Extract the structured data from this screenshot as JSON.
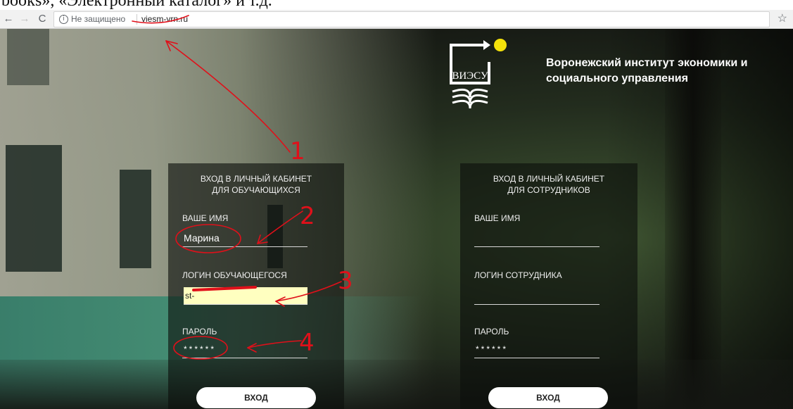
{
  "document_strip_text": "books», «Электронный каталог» и т.д.",
  "browser": {
    "back_icon": "←",
    "forward_icon": "→",
    "reload_icon": "C",
    "info_icon": "i",
    "security_label": "Не защищено",
    "url": "viesm-vrn.ru",
    "star_icon": "☆"
  },
  "header": {
    "logo_text": "ВИЭСУ",
    "org_line1": "Воронежский институт экономики и",
    "org_line2": "социального управления"
  },
  "student_panel": {
    "title_line1": "ВХОД В ЛИЧНЫЙ КАБИНЕТ",
    "title_line2": "ДЛЯ ОБУЧАЮЩИХСЯ",
    "name_label": "ВАШЕ ИМЯ",
    "name_value": "Марина",
    "login_label": "ЛОГИН ОБУЧАЮЩЕГОСЯ",
    "login_value": "st-",
    "password_label": "ПАРОЛЬ",
    "password_value": "******",
    "button_label": "ВХОД"
  },
  "staff_panel": {
    "title_line1": "ВХОД В ЛИЧНЫЙ КАБИНЕТ",
    "title_line2": "ДЛЯ СОТРУДНИКОВ",
    "name_label": "ВАШЕ ИМЯ",
    "name_value": "",
    "login_label": "ЛОГИН СОТРУДНИКА",
    "login_value": "",
    "password_label": "ПАРОЛЬ",
    "password_value": "******",
    "button_label": "ВХОД"
  },
  "annotations": {
    "color": "#e0101a",
    "marks": [
      "1",
      "2",
      "3",
      "4"
    ]
  },
  "colors": {
    "logo_dot": "#f5e20a",
    "login_highlight": "#ffffc0"
  }
}
